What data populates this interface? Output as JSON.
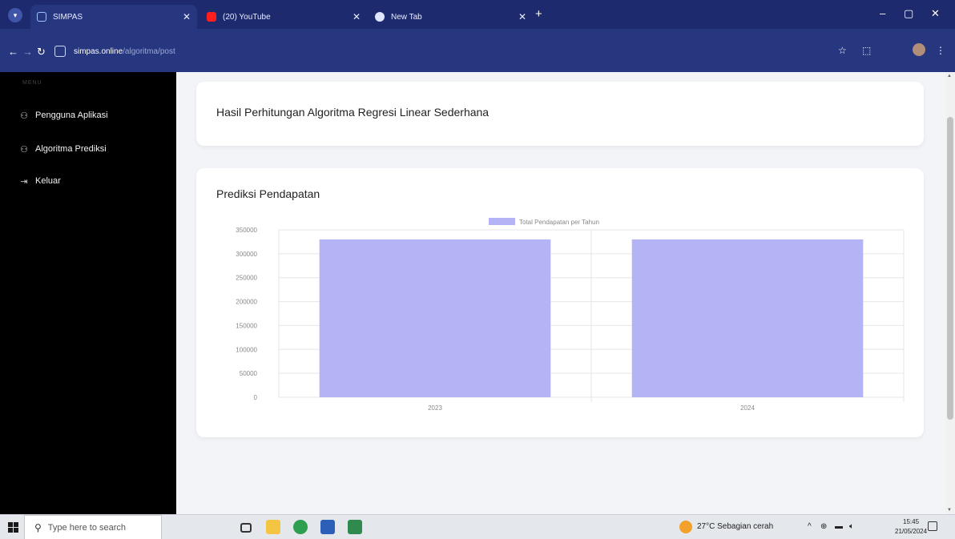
{
  "browser": {
    "tabs": [
      {
        "label": "SIMPAS",
        "icon": "simpas-tab-icon",
        "active": true
      },
      {
        "label": "(20) YouTube",
        "icon": "youtube-icon",
        "active": false
      },
      {
        "label": "New Tab",
        "icon": "globe-icon",
        "active": false
      }
    ],
    "new_tab_glyph": "+",
    "address": {
      "host": "simpas.online",
      "path": "/algoritma/post"
    }
  },
  "sidebar": {
    "heading": "MENU",
    "items": [
      {
        "label": "Pengguna Aplikasi",
        "icon": "user-icon"
      },
      {
        "label": "Algoritma Prediksi",
        "icon": "user-icon"
      },
      {
        "label": "Keluar",
        "icon": "logout-icon"
      }
    ]
  },
  "main": {
    "header_card_title": "Hasil Perhitungan Algoritma Regresi Linear Sederhana",
    "chart_card_title": "Prediksi Pendapatan"
  },
  "chart_data": {
    "type": "bar",
    "categories": [
      "2023",
      "2024"
    ],
    "series": [
      {
        "name": "Total Pendapatan per Tahun",
        "values": [
          330000,
          330000
        ],
        "color": "#b3b3f5"
      }
    ],
    "ylim": [
      0,
      350000
    ],
    "yticks": [
      0,
      50000,
      100000,
      150000,
      200000,
      250000,
      300000,
      350000
    ],
    "grid": true,
    "legend": "top-center"
  },
  "taskbar": {
    "search_placeholder": "Type here to search",
    "weather": "27°C  Sebagian cerah",
    "time": "15:45",
    "date": "21/05/2024"
  },
  "colors": {
    "tabstrip": "#1e2a6e",
    "toolbar": "#27377f",
    "sidebar": "#000000",
    "bar": "#b3b3f5",
    "page_bg": "#f3f4f8"
  }
}
